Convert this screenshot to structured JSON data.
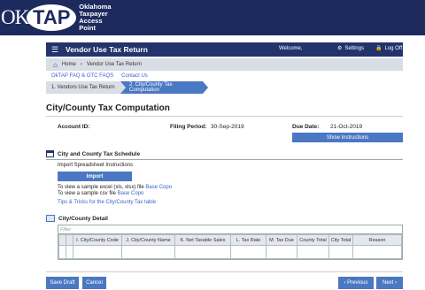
{
  "header": {
    "logo_ok": "OK",
    "logo_tap": "TAP",
    "logo_lines": [
      "Oklahoma",
      "Taxpayer",
      "Access",
      "Point"
    ]
  },
  "titlebar": {
    "title": "Vendor Use Tax Return",
    "welcome": "Welcome,",
    "settings": "Settings",
    "logoff": "Log Off"
  },
  "breadcrumb": {
    "home": "Home",
    "current": "Vendor Use Tax Return"
  },
  "links": {
    "faq": "OkTAP FAQ & OTC FAQS",
    "contact": "Contact Us"
  },
  "steps": {
    "step1": "1. Vendors Use Tax Return",
    "step2": "2. City/County Tax Computation"
  },
  "page": {
    "title": "City/County Tax Computation"
  },
  "info": {
    "account_label": "Account ID:",
    "filing_label": "Filing Period:",
    "filing_value": "30-Sep-2019",
    "due_label": "Due Date:",
    "due_value": "21-Oct-2019",
    "show_instructions": "Show Instructions"
  },
  "schedule": {
    "heading": "City and County Tax Schedule",
    "import_text": "Import Spreadsheet Instructions",
    "import_button": "Import",
    "excel_text": "To view a sample excel (xls, xlsx) file",
    "excel_link": "Base Copo",
    "csv_text": "To view a sample csv file",
    "csv_link": "Base Copo",
    "tips": "Tips & Tricks for the City/County Tax table"
  },
  "detail": {
    "heading": "City/County Detail",
    "filter": "Filter",
    "columns": [
      "I. City/County Code",
      "J. City/County Name",
      "K. Net Taxable Sales",
      "L. Tax Rate",
      "M. Tax Due",
      "County Total",
      "City Total",
      "Reason"
    ]
  },
  "footer": {
    "save": "Save Draft",
    "cancel": "Cancel",
    "previous": "Previous",
    "next": "Next"
  }
}
